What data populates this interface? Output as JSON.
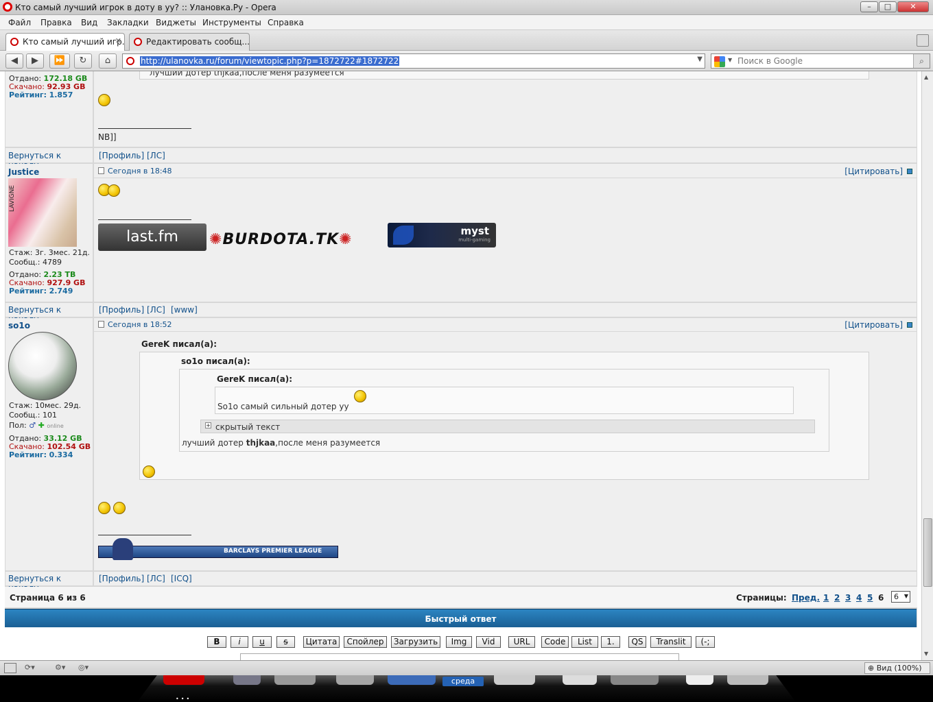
{
  "window": {
    "title": "Кто самый лучший игрок в доту в уу? :: Улановка.Ру - Opera"
  },
  "menu": [
    "Файл",
    "Правка",
    "Вид",
    "Закладки",
    "Виджеты",
    "Инструменты",
    "Справка"
  ],
  "tabs": [
    {
      "label": "Кто самый лучший игр...",
      "close": "✕"
    },
    {
      "label": "Редактировать сообщ...",
      "close": "✕"
    }
  ],
  "address": {
    "url": "http://ulanovka.ru/forum/viewtopic.php?p=1872722#1872722",
    "search_placeholder": "Поиск в Google"
  },
  "post0": {
    "given_label": "Отдано:",
    "given": "172.18 GB",
    "down_label": "Скачано:",
    "down": "92.93 GB",
    "rating_label": "Рейтинг:",
    "rating": "1.857",
    "sig": "NB]]",
    "back": "Вернуться к началу",
    "links": [
      "[Профиль]",
      "[ЛС]"
    ],
    "quote_tail": "лучший дотер thjkaa,после меня разумеется"
  },
  "post1": {
    "user": "Justice",
    "date": "Сегодня в 18:48",
    "quote": "[Цитировать]",
    "stazh": "Стаж: 3г. 3мес. 21д.",
    "soobsh": "Сообщ.: 4789",
    "given_label": "Отдано:",
    "given": "2.23 TB",
    "down_label": "Скачано:",
    "down": "927.9 GB",
    "rating_label": "Рейтинг:",
    "rating": "2.749",
    "back": "Вернуться к началу",
    "links": [
      "[Профиль]",
      "[ЛС]",
      "[www]"
    ],
    "avatar_text": "LAVIGNE",
    "banner1": "last.fm",
    "banner2": "BURDOTA.TK",
    "banner3": "myst",
    "banner3_sub": "multi-gaming"
  },
  "post2": {
    "user": "so1o",
    "date": "Сегодня в 18:52",
    "quote": "[Цитировать]",
    "stazh": "Стаж: 10мес. 29д.",
    "soobsh": "Сообщ.: 101",
    "pol": "Пол:",
    "online": "online",
    "given_label": "Отдано:",
    "given": "33.12 GB",
    "down_label": "Скачано:",
    "down": "102.54 GB",
    "rating_label": "Рейтинг:",
    "rating": "0.334",
    "q1_title": "GereK писал(а):",
    "q2_title": "so1o писал(а):",
    "q3_title": "GereK писал(а):",
    "q3_text": "So1o самый сильный дотер уу",
    "hidden": "скрытый текст",
    "q2_text_pre": "лучший дотер ",
    "q2_text_bold": "thjkaa",
    "q2_text_post": ",после меня разумеется",
    "banner": "BARCLAYS PREMIER LEAGUE",
    "back": "Вернуться к началу",
    "links": [
      "[Профиль]",
      "[ЛС]",
      "[ICQ]"
    ]
  },
  "pager": {
    "left": "Страница 6 из 6",
    "label": "Страницы:",
    "prev": "Пред.",
    "pages": [
      "1",
      "2",
      "3",
      "4",
      "5"
    ],
    "current": "6",
    "select": "6"
  },
  "quickreply": {
    "title": "Быстрый ответ",
    "buttons": [
      "B",
      "i",
      "u",
      "s",
      "Цитата",
      "Спойлер",
      "Загрузить",
      "Img",
      "Vid",
      "URL",
      "Code",
      "List",
      "1.",
      "QS",
      "Translit",
      "(-;"
    ]
  },
  "status": {
    "zoom": "Вид (100%)"
  },
  "dock": {
    "label": "среда"
  },
  "colors": {
    "header_bar": "#1e6ea5",
    "link": "#11508a",
    "green": "#1b8a1b",
    "red": "#b01010"
  }
}
